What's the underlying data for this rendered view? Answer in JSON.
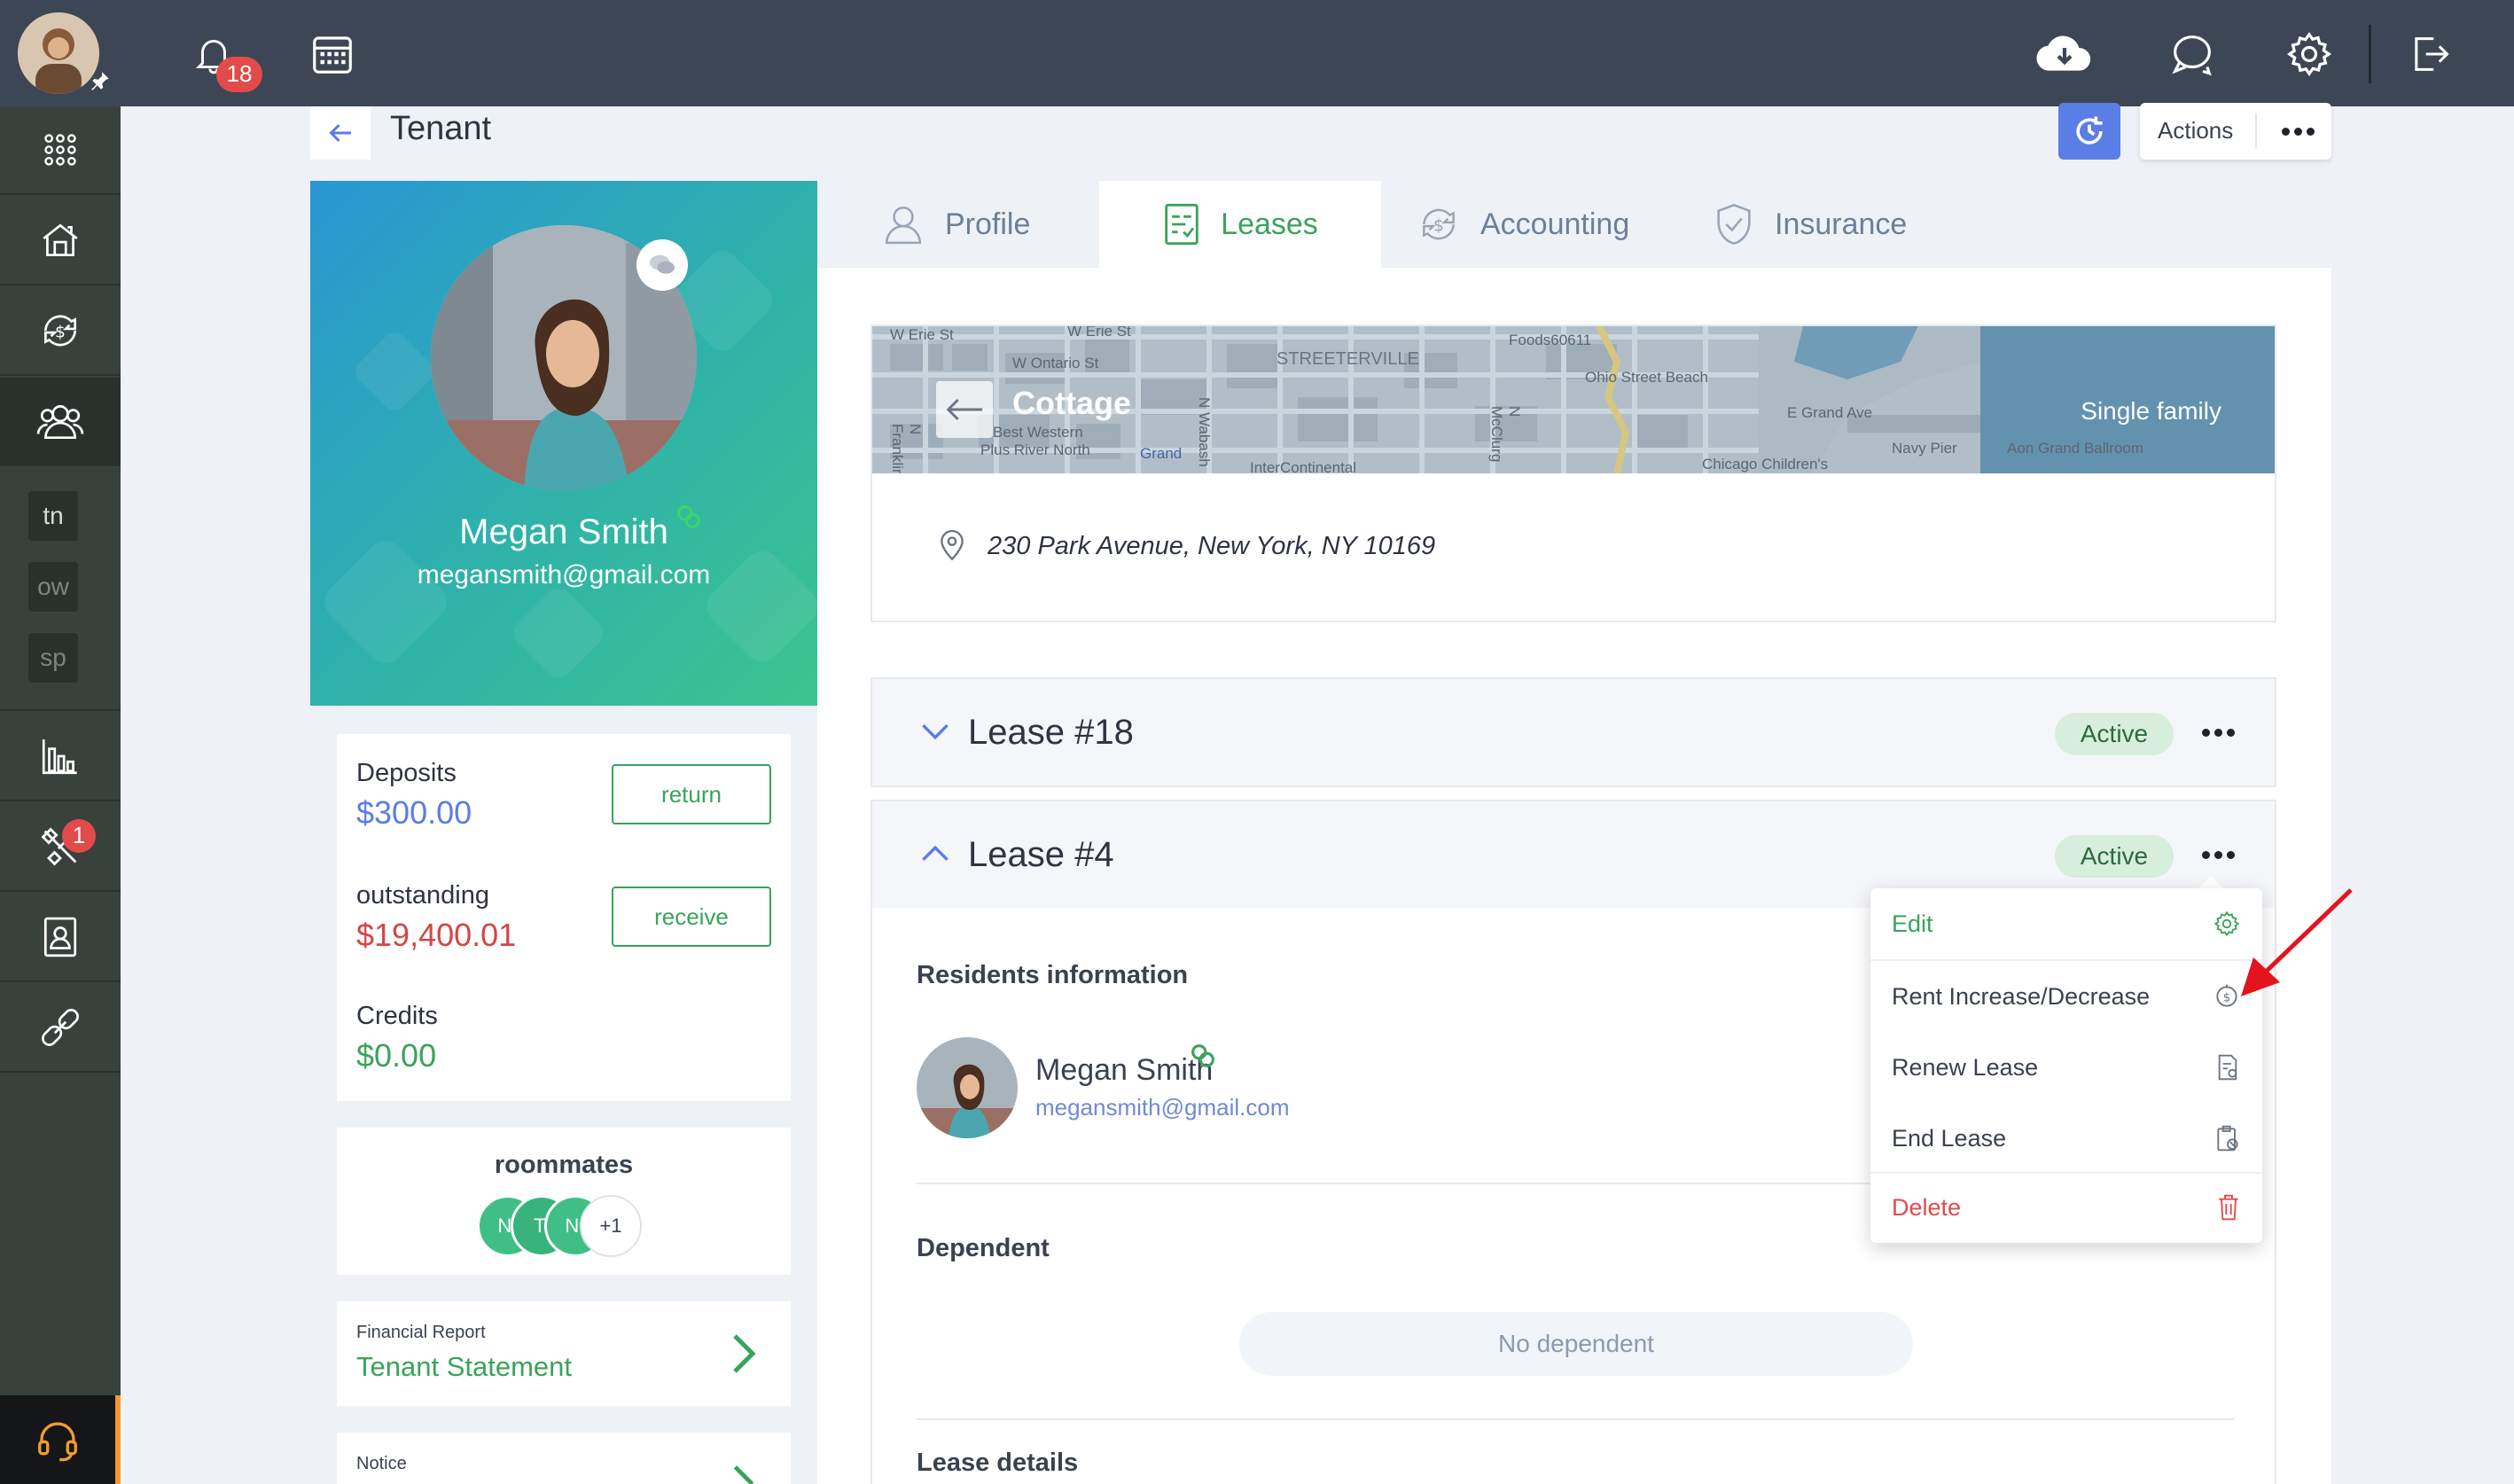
{
  "topbar": {
    "notification_count": "18",
    "icons": [
      "bell-icon",
      "calendar-icon",
      "cloud-download-icon",
      "chat-icon",
      "gear-icon",
      "logout-icon"
    ]
  },
  "sidebar": {
    "chips": [
      "tn",
      "ow",
      "sp"
    ],
    "maintenance_badge": "1"
  },
  "header": {
    "title": "Tenant",
    "actions_label": "Actions"
  },
  "profile": {
    "name": "Megan Smith",
    "email": "megansmith@gmail.com"
  },
  "finance": {
    "deposits_label": "Deposits",
    "deposits_value": "$300.00",
    "return_label": "return",
    "outstanding_label": "outstanding",
    "outstanding_value": "$19,400.01",
    "receive_label": "receive",
    "credits_label": "Credits",
    "credits_value": "$0.00"
  },
  "roommates": {
    "title": "roommates",
    "initials": [
      "N(",
      "T'",
      "N("
    ],
    "more": "+1"
  },
  "reports": {
    "financial_caption": "Financial Report",
    "financial_link": "Tenant Statement",
    "notice_caption": "Notice"
  },
  "tabs": [
    {
      "label": "Profile"
    },
    {
      "label": "Leases"
    },
    {
      "label": "Accounting"
    },
    {
      "label": "Insurance"
    }
  ],
  "property": {
    "name": "Cottage",
    "type": "Single family",
    "address": "230 Park Avenue, New York, NY 10169",
    "map_labels": [
      "W Erie St",
      "W Erie St",
      "W Ontario St",
      "STREETERVILLE",
      "Foods60611",
      "Ohio Street Beach",
      "E Grand Ave",
      "Navy Pier",
      "Aon Grand Ballroom",
      "Best Western",
      "Plus River North",
      "Grand",
      "InterContinental",
      "Chicago Children's",
      "N Franklin",
      "N Wabash",
      "N McClurg"
    ]
  },
  "leases": [
    {
      "title": "Lease #18",
      "status": "Active"
    },
    {
      "title": "Lease #4",
      "status": "Active"
    }
  ],
  "lease4": {
    "residents_title": "Residents information",
    "resident_name": "Megan Smith",
    "resident_email": "megansmith@gmail.com",
    "dependent_title": "Dependent",
    "no_dependent": "No dependent",
    "details_title": "Lease details"
  },
  "menu": {
    "edit": "Edit",
    "rent_change": "Rent Increase/Decrease",
    "renew": "Renew Lease",
    "end": "End Lease",
    "delete": "Delete"
  },
  "colors": {
    "topbar": "#3d4654",
    "sidebar": "#38413c",
    "accent_green": "#3aa35a",
    "accent_blue": "#5b7de6",
    "danger": "#e34a4a",
    "support_accent": "#f29a2e"
  }
}
